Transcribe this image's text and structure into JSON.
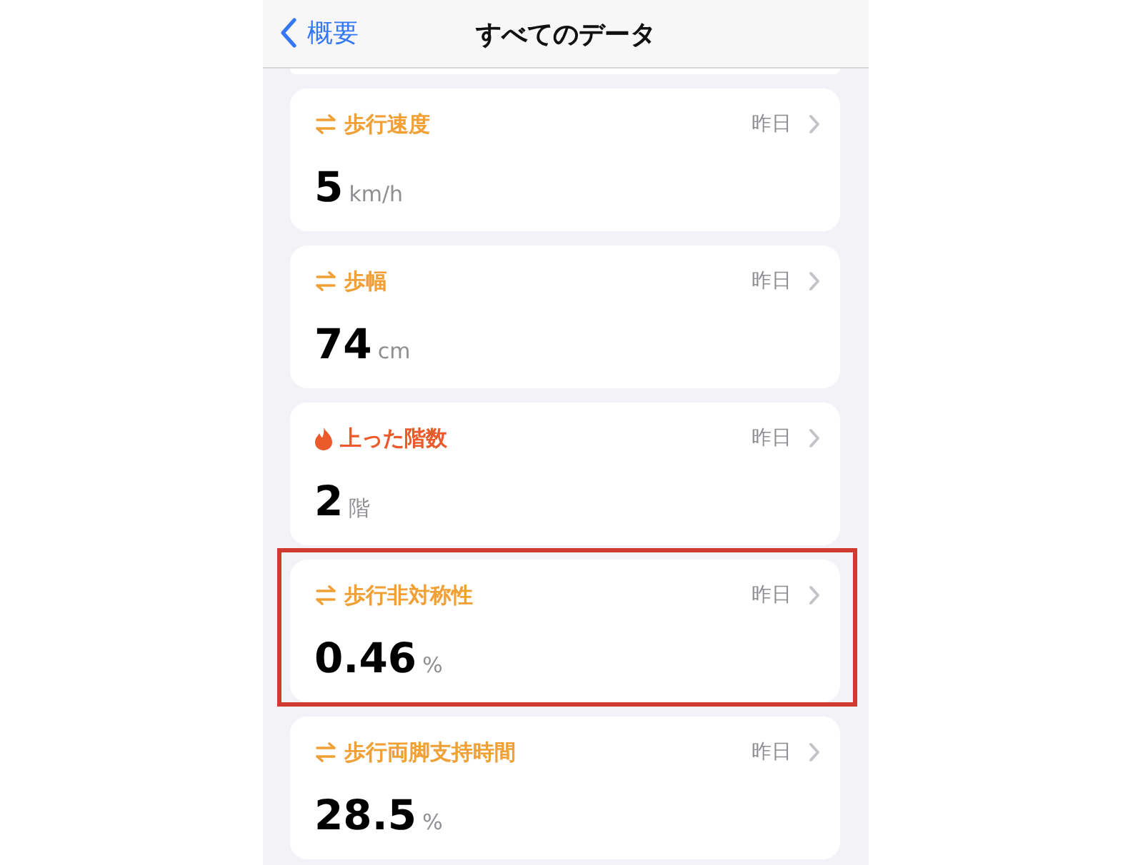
{
  "nav": {
    "back_label": "概要",
    "title": "すべてのデータ"
  },
  "cards": [
    {
      "kind": "mobility",
      "title": "歩行速度",
      "date": "昨日",
      "value": "5",
      "unit": "km/h",
      "highlighted": false
    },
    {
      "kind": "mobility",
      "title": "歩幅",
      "date": "昨日",
      "value": "74",
      "unit": "cm",
      "highlighted": false
    },
    {
      "kind": "activity",
      "title": "上った階数",
      "date": "昨日",
      "value": "2",
      "unit": "階",
      "highlighted": false
    },
    {
      "kind": "mobility",
      "title": "歩行非対称性",
      "date": "昨日",
      "value": "0.46",
      "unit": "%",
      "highlighted": true
    },
    {
      "kind": "mobility",
      "title": "歩行両脚支持時間",
      "date": "昨日",
      "value": "28.5",
      "unit": "%",
      "highlighted": false
    }
  ]
}
